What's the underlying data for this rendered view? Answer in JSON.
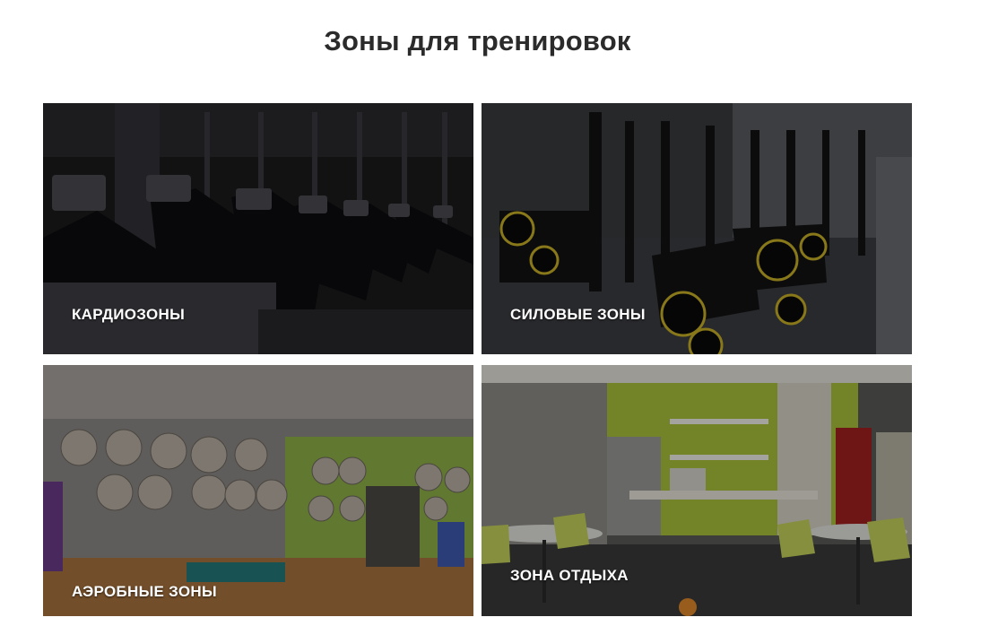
{
  "section": {
    "title": "Зоны для тренировок"
  },
  "zones": [
    {
      "label": "КАРДИОЗОНЫ",
      "image": "cardio-zone-photo"
    },
    {
      "label": "СИЛОВЫЕ ЗОНЫ",
      "image": "strength-zone-photo"
    },
    {
      "label": "АЭРОБНЫЕ ЗОНЫ",
      "image": "aerobic-zone-photo"
    },
    {
      "label": "ЗОНА ОТДЫХА",
      "image": "rest-zone-photo"
    }
  ]
}
